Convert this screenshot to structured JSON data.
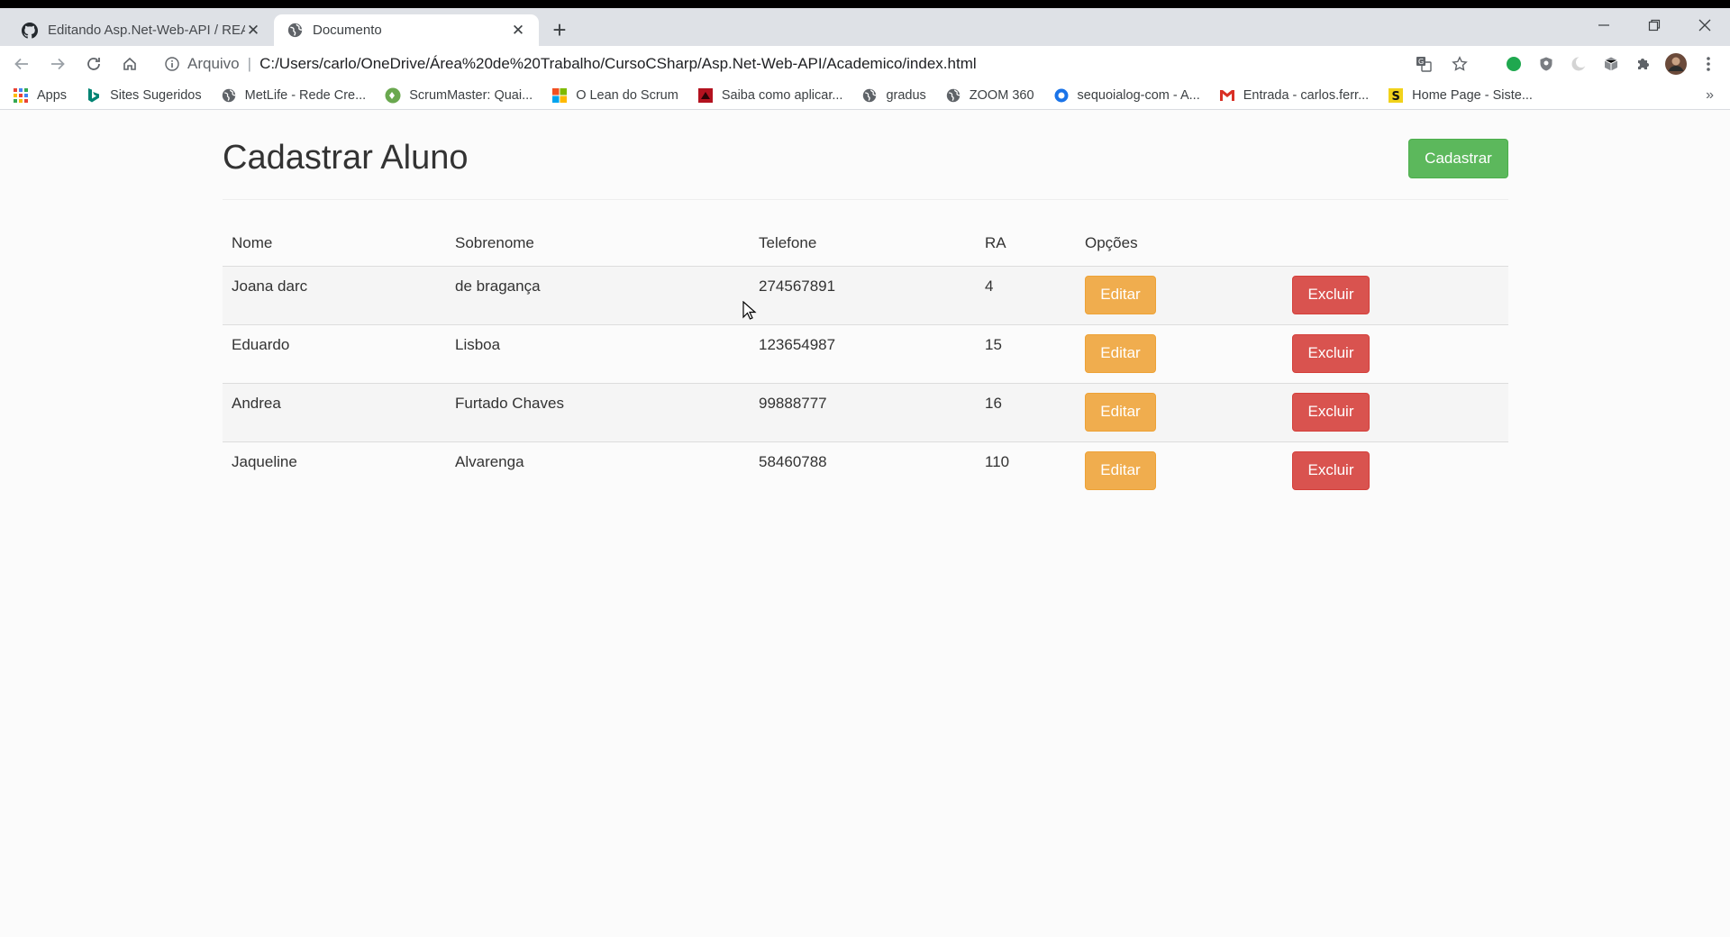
{
  "browser": {
    "tabs": [
      {
        "title": "Editando Asp.Net-Web-API / README.md",
        "active": false
      },
      {
        "title": "Documento",
        "active": true
      }
    ],
    "address": {
      "scheme_label": "Arquivo",
      "separator": "|",
      "url": "C:/Users/carlo/OneDrive/Área%20de%20Trabalho/CursoCSharp/Asp.Net-Web-API/Academico/index.html"
    },
    "bookmarks": [
      {
        "label": "Apps",
        "icon": "apps-grid-icon"
      },
      {
        "label": "Sites Sugeridos",
        "icon": "bing-icon"
      },
      {
        "label": "MetLife - Rede Cre...",
        "icon": "globe-icon"
      },
      {
        "label": "ScrumMaster: Quai...",
        "icon": "scrum-icon"
      },
      {
        "label": "O Lean do Scrum",
        "icon": "microsoft-icon"
      },
      {
        "label": "Saiba como aplicar...",
        "icon": "red-square-icon"
      },
      {
        "label": "gradus",
        "icon": "globe-icon"
      },
      {
        "label": "ZOOM 360",
        "icon": "globe-icon"
      },
      {
        "label": "sequoialog-com - A...",
        "icon": "circle-icon"
      },
      {
        "label": "Entrada - carlos.ferr...",
        "icon": "gmail-icon"
      },
      {
        "label": "Home Page - Siste...",
        "icon": "s-logo-icon"
      }
    ],
    "bookmarks_more": "»"
  },
  "page": {
    "title": "Cadastrar Aluno",
    "register_button": "Cadastrar",
    "table": {
      "headers": [
        "Nome",
        "Sobrenome",
        "Telefone",
        "RA",
        "Opções"
      ],
      "rows": [
        {
          "nome": "Joana darc",
          "sobrenome": "de bragança",
          "telefone": "274567891",
          "ra": "4"
        },
        {
          "nome": "Eduardo",
          "sobrenome": "Lisboa",
          "telefone": "123654987",
          "ra": "15"
        },
        {
          "nome": "Andrea",
          "sobrenome": "Furtado Chaves",
          "telefone": "99888777",
          "ra": "16"
        },
        {
          "nome": "Jaqueline",
          "sobrenome": "Alvarenga",
          "telefone": "58460788",
          "ra": "110"
        }
      ],
      "edit_label": "Editar",
      "delete_label": "Excluir"
    }
  },
  "colors": {
    "success": "#5cb85c",
    "warning": "#f0ad4e",
    "danger": "#d9534f"
  }
}
